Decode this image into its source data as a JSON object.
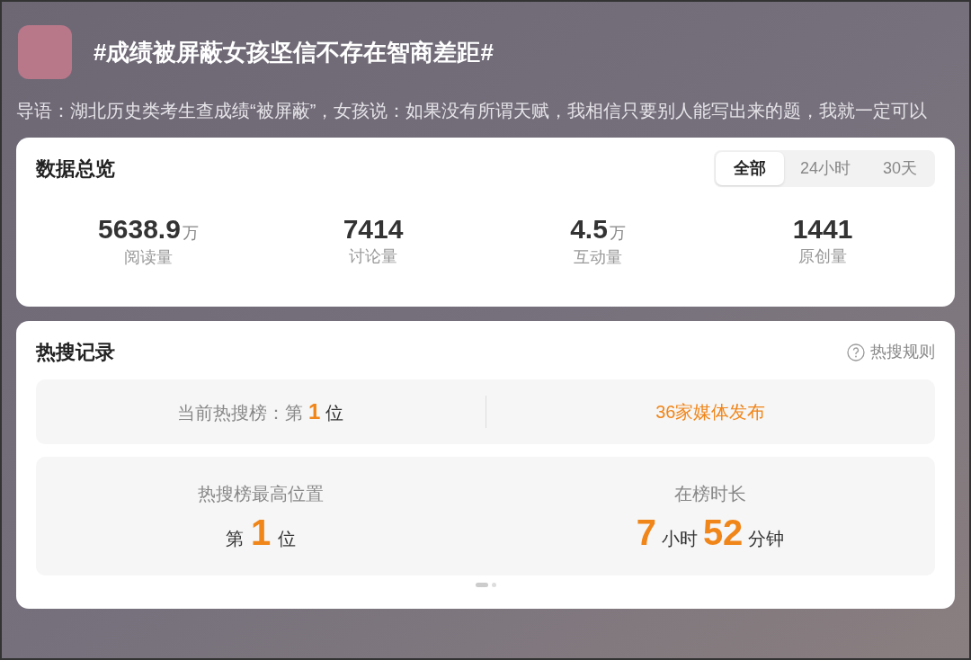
{
  "header": {
    "title": "#成绩被屏蔽女孩坚信不存在智商差距#",
    "intro": "导语：湖北历史类考生查成绩“被屏蔽”，女孩说：如果没有所谓天赋，我相信只要别人能写出来的题，我就一定可以"
  },
  "overview": {
    "title": "数据总览",
    "tabs": [
      {
        "label": "全部",
        "selected": true
      },
      {
        "label": "24小时",
        "selected": false
      },
      {
        "label": "30天",
        "selected": false
      }
    ],
    "stats": [
      {
        "value": "5638.9",
        "unit": "万",
        "label": "阅读量"
      },
      {
        "value": "7414",
        "label": "讨论量"
      },
      {
        "value": "4.5",
        "unit": "万",
        "label": "互动量"
      },
      {
        "value": "1441",
        "label": "原创量"
      }
    ]
  },
  "hot_search": {
    "title": "热搜记录",
    "rules_link": "热搜规则",
    "current": {
      "label": "当前热搜榜：第",
      "rank": "1",
      "suffix": "位",
      "media": "36家媒体发布"
    },
    "peak": {
      "label": "热搜榜最高位置",
      "prefix": "第",
      "rank": "1",
      "suffix": "位"
    },
    "duration": {
      "label": "在榜时长",
      "hours": "7",
      "hours_unit": "小时",
      "minutes": "52",
      "minutes_unit": "分钟"
    },
    "pager": [
      {
        "selected": true
      },
      {
        "selected": false
      }
    ]
  }
}
